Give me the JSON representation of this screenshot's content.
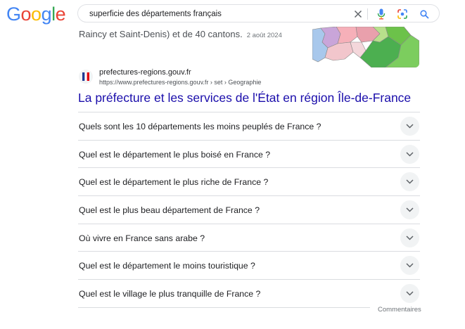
{
  "header": {
    "logo_letters": [
      "G",
      "o",
      "o",
      "g",
      "l",
      "e"
    ],
    "logo_colors": [
      "#4285F4",
      "#EA4335",
      "#FBBC05",
      "#4285F4",
      "#34A853",
      "#EA4335"
    ],
    "search_query": "superficie des départements français"
  },
  "snippet": {
    "text": "Raincy et Saint-Denis) et de 40 cantons.",
    "date": "2 août 2024"
  },
  "result": {
    "site_name": "prefectures-regions.gouv.fr",
    "url": "https://www.prefectures-regions.gouv.fr › set › Geographie",
    "title": "La préfecture et les services de l'État en région Île-de-France"
  },
  "faq": {
    "questions": [
      "Quels sont les 10 départements les moins peuplés de France ?",
      "Quel est le département le plus boisé en France ?",
      "Quel est le département le plus riche de France ?",
      "Quel est le plus beau département de France ?",
      "Où vivre en France sans arabe ?",
      "Quel est le département le moins touristique ?",
      "Quel est le village le plus tranquille de France ?"
    ],
    "comments_label": "Commentaires"
  },
  "colors": {
    "link": "#1a0dab",
    "text": "#202124",
    "muted": "#70757a"
  },
  "icons": [
    "clear-icon",
    "microphone-icon",
    "lens-icon",
    "search-icon",
    "chevron-down-icon",
    "french-flag-icon"
  ]
}
